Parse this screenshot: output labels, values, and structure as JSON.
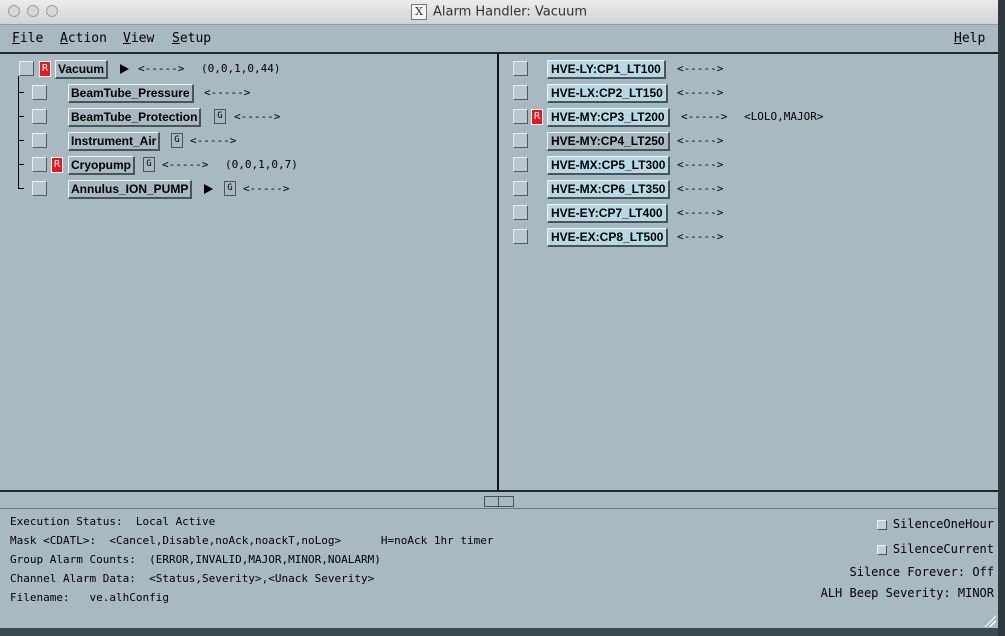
{
  "window": {
    "title": "Alarm Handler: Vacuum"
  },
  "menu": {
    "file": "File",
    "action": "Action",
    "view": "View",
    "setup": "Setup",
    "help": "Help"
  },
  "colors": {
    "background": "#a9b9c2",
    "channel_button": "#b6d9e5",
    "alarm_red": "#e8191e"
  },
  "group_tree": {
    "root": {
      "name": "Vacuum",
      "severity_flag": "R",
      "link": "<----->",
      "counts": "(0,0,1,0,44)"
    },
    "children": [
      {
        "name": "BeamTube_Pressure",
        "severity_flag": "",
        "guidance": "",
        "link": "<----->",
        "counts": ""
      },
      {
        "name": "BeamTube_Protection",
        "severity_flag": "",
        "guidance": "G",
        "link": "<----->",
        "counts": ""
      },
      {
        "name": "Instrument_Air",
        "severity_flag": "",
        "guidance": "G",
        "link": "<----->",
        "counts": ""
      },
      {
        "name": "Cryopump",
        "severity_flag": "R",
        "guidance": "G",
        "link": "<----->",
        "counts": "(0,0,1,0,7)"
      },
      {
        "name": "Annulus_ION_PUMP",
        "severity_flag": "",
        "guidance": "G",
        "link": "<----->",
        "counts": ""
      }
    ]
  },
  "channels": [
    {
      "name": "HVE-LY:CP1_LT100",
      "severity_flag": "",
      "link": "<----->",
      "status": ""
    },
    {
      "name": "HVE-LX:CP2_LT150",
      "severity_flag": "",
      "link": "<----->",
      "status": ""
    },
    {
      "name": "HVE-MY:CP3_LT200",
      "severity_flag": "R",
      "link": "<----->",
      "status": "<LOLO,MAJOR>"
    },
    {
      "name": "HVE-MY:CP4_LT250",
      "severity_flag": "",
      "link": "<----->",
      "status": ""
    },
    {
      "name": "HVE-MX:CP5_LT300",
      "severity_flag": "",
      "link": "<----->",
      "status": ""
    },
    {
      "name": "HVE-MX:CP6_LT350",
      "severity_flag": "",
      "link": "<----->",
      "status": ""
    },
    {
      "name": "HVE-EY:CP7_LT400",
      "severity_flag": "",
      "link": "<----->",
      "status": ""
    },
    {
      "name": "HVE-EX:CP8_LT500",
      "severity_flag": "",
      "link": "<----->",
      "status": ""
    }
  ],
  "status_panel": {
    "execution_status": "Execution Status:  Local Active",
    "mask": "Mask <CDATL>:  <Cancel,Disable,noAck,noackT,noLog>      H=noAck 1hr timer",
    "group_alarm_counts": "Group Alarm Counts:  (ERROR,INVALID,MAJOR,MINOR,NOALARM)",
    "channel_alarm_data": "Channel Alarm Data:  <Status,Severity>,<Unack Severity>",
    "filename": "Filename:   ve.alhConfig"
  },
  "silence": {
    "one_hour": "SilenceOneHour",
    "current": "SilenceCurrent",
    "forever": "Silence Forever:  Off",
    "beep_severity": "ALH Beep Severity: MINOR"
  }
}
